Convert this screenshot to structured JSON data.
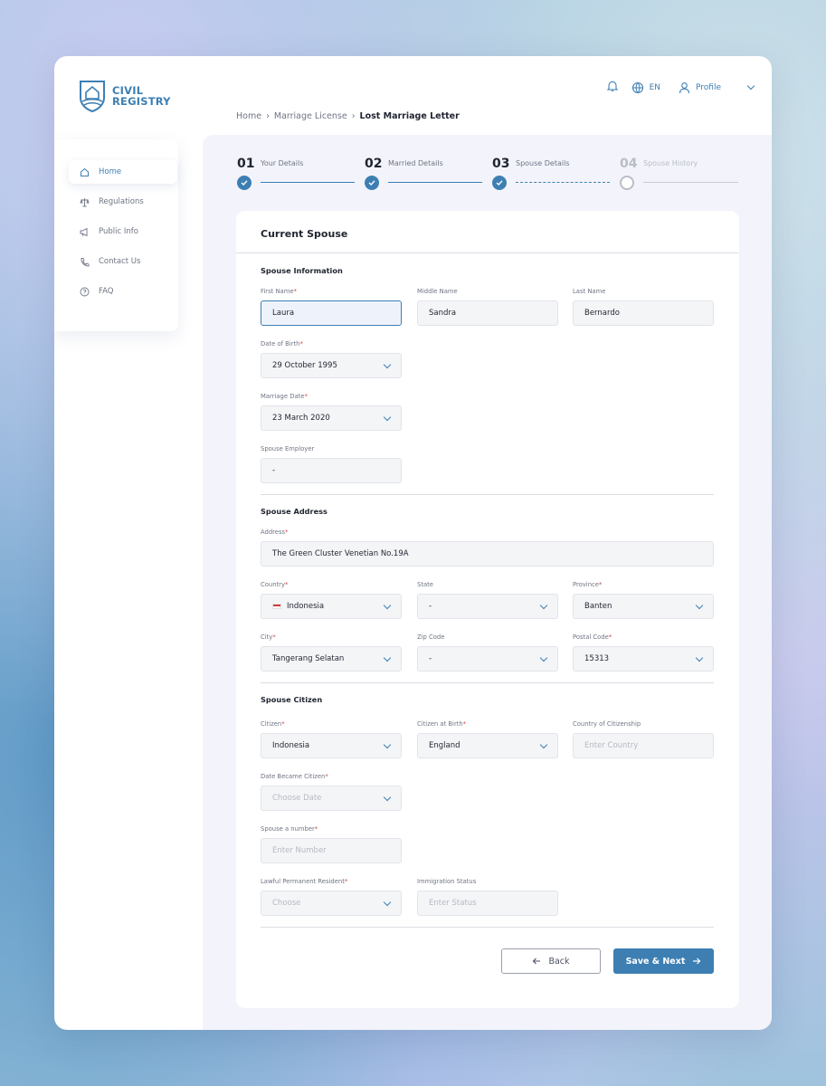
{
  "app": {
    "logo_line1": "CIVIL",
    "logo_line2": "REGISTRY"
  },
  "topbar": {
    "language": "EN",
    "profile_label": "Profile"
  },
  "breadcrumb": {
    "items": [
      "Home",
      "Marriage License"
    ],
    "current": "Lost Marriage Letter"
  },
  "sidebar": {
    "items": [
      {
        "label": "Home",
        "icon": "home-icon",
        "active": true
      },
      {
        "label": "Regulations",
        "icon": "scale-icon"
      },
      {
        "label": "Public Info",
        "icon": "megaphone-icon"
      },
      {
        "label": "Contact Us",
        "icon": "phone-icon"
      },
      {
        "label": "FAQ",
        "icon": "help-circle-icon"
      }
    ]
  },
  "stepper": {
    "steps": [
      {
        "num": "01",
        "label": "Your Details",
        "status": "done"
      },
      {
        "num": "02",
        "label": "Married Details",
        "status": "done"
      },
      {
        "num": "03",
        "label": "Spouse Details",
        "status": "current"
      },
      {
        "num": "04",
        "label": "Spouse History",
        "status": "pending"
      }
    ]
  },
  "form": {
    "title": "Current Spouse",
    "sections": {
      "info": "Spouse Information",
      "address": "Spouse Address",
      "citizen": "Spouse Citizen"
    },
    "first_name": {
      "label": "First Name",
      "value": "Laura"
    },
    "middle_name": {
      "label": "Middle Name",
      "value": "Sandra"
    },
    "last_name": {
      "label": "Last Name",
      "value": "Bernardo"
    },
    "dob": {
      "label": "Date of Birth",
      "value": "29 October 1995"
    },
    "marriage_date": {
      "label": "Marriage Date",
      "value": "23 March 2020"
    },
    "employer": {
      "label": "Spouse Employer",
      "value": "-"
    },
    "address": {
      "label": "Address",
      "value": "The Green Cluster Venetian No.19A"
    },
    "country": {
      "label": "Country",
      "value": "Indonesia"
    },
    "state": {
      "label": "State",
      "value": "-"
    },
    "province": {
      "label": "Province",
      "value": "Banten"
    },
    "city": {
      "label": "City",
      "value": "Tangerang Selatan"
    },
    "zip": {
      "label": "Zip Code",
      "value": "-"
    },
    "postal": {
      "label": "Postal Code",
      "value": "15313"
    },
    "citizen": {
      "label": "Citizen",
      "value": "Indonesia"
    },
    "citizen_birth": {
      "label": "Citizen at Birth",
      "value": "England"
    },
    "country_citizenship": {
      "label": "Country of Citizenship",
      "placeholder": "Enter Country"
    },
    "date_citizen": {
      "label": "Date Became Citizen",
      "placeholder": "Choose Date"
    },
    "spouse_number": {
      "label": "Spouse a number",
      "placeholder": "Enter Number"
    },
    "lpr": {
      "label": "Lawful Permanent Resident",
      "placeholder": "Choose"
    },
    "immigration": {
      "label": "Immigration Status",
      "placeholder": "Enter Status"
    }
  },
  "actions": {
    "back": "Back",
    "save": "Save & Next"
  },
  "colors": {
    "accent": "#3d7fb3",
    "required": "#d04a4a"
  }
}
